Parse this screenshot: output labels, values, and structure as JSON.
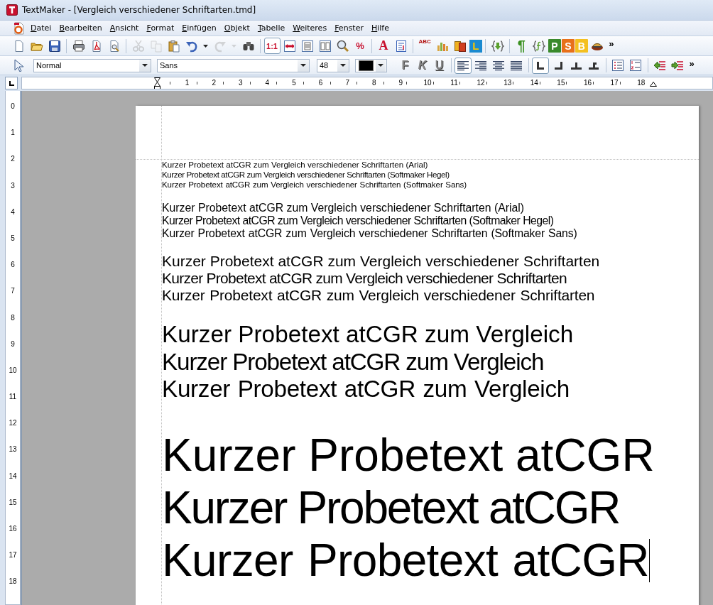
{
  "window": {
    "title": "TextMaker - [Vergleich verschiedener Schriftarten.tmd]"
  },
  "menu": [
    {
      "label": "Datei"
    },
    {
      "label": "Bearbeiten"
    },
    {
      "label": "Ansicht"
    },
    {
      "label": "Format"
    },
    {
      "label": "Einfügen"
    },
    {
      "label": "Objekt"
    },
    {
      "label": "Tabelle"
    },
    {
      "label": "Weiteres"
    },
    {
      "label": "Fenster"
    },
    {
      "label": "Hilfe"
    }
  ],
  "toolbar": [
    {
      "kind": "button",
      "disabled": false
    },
    {
      "kind": "button",
      "disabled": false
    },
    {
      "kind": "button",
      "disabled": false
    },
    {
      "kind": "separator"
    },
    {
      "kind": "button",
      "disabled": false
    },
    {
      "kind": "button",
      "disabled": false
    },
    {
      "kind": "button",
      "disabled": false
    },
    {
      "kind": "separator"
    },
    {
      "kind": "button",
      "disabled": true
    },
    {
      "kind": "button",
      "disabled": true
    },
    {
      "kind": "button",
      "disabled": false
    },
    {
      "kind": "button",
      "disabled": false
    },
    {
      "kind": "caret",
      "disabled": false
    },
    {
      "kind": "button",
      "disabled": true
    },
    {
      "kind": "caret",
      "disabled": true
    },
    {
      "kind": "button",
      "disabled": false
    },
    {
      "kind": "separator"
    },
    {
      "kind": "button",
      "label": "1:1",
      "selected": true,
      "disabled": false
    },
    {
      "kind": "button",
      "disabled": false
    },
    {
      "kind": "button",
      "disabled": false
    },
    {
      "kind": "button",
      "disabled": false
    },
    {
      "kind": "button",
      "disabled": false
    },
    {
      "kind": "button",
      "label": "%",
      "disabled": false
    },
    {
      "kind": "separator"
    },
    {
      "kind": "button",
      "label": "A",
      "disabled": false
    },
    {
      "kind": "button",
      "disabled": false
    },
    {
      "kind": "separator"
    },
    {
      "kind": "button",
      "label": "ABC",
      "disabled": false
    },
    {
      "kind": "button",
      "disabled": false
    },
    {
      "kind": "button",
      "disabled": false
    },
    {
      "kind": "button",
      "label": "L",
      "disabled": false
    },
    {
      "kind": "separator"
    },
    {
      "kind": "button",
      "disabled": false
    },
    {
      "kind": "separator"
    },
    {
      "kind": "button",
      "label": "¶",
      "disabled": false
    },
    {
      "kind": "button",
      "disabled": false
    },
    {
      "kind": "button",
      "label": "P",
      "disabled": false
    },
    {
      "kind": "button",
      "label": "S",
      "disabled": false
    },
    {
      "kind": "button",
      "label": "B",
      "disabled": false
    },
    {
      "kind": "button",
      "disabled": false
    },
    {
      "kind": "overflow",
      "label": "»"
    }
  ],
  "format_bar": {
    "style": "Normal",
    "font": "Sans",
    "size": "48",
    "color": "#000000",
    "text_styles": [
      {
        "label": "F",
        "selected": false
      },
      {
        "label": "K",
        "selected": false
      },
      {
        "label": "U",
        "selected": false
      }
    ],
    "alignment": [
      {
        "selected": true
      },
      {
        "selected": false
      },
      {
        "selected": false
      },
      {
        "selected": false
      }
    ],
    "tab_stops": [
      {
        "selected": true
      },
      {
        "selected": false
      },
      {
        "selected": false
      },
      {
        "selected": false
      }
    ],
    "overflow": "»"
  },
  "horizontal_ruler": [
    "1",
    "2",
    "3",
    "4",
    "5",
    "6",
    "7",
    "8",
    "9",
    "10",
    "11",
    "12",
    "13",
    "14",
    "15",
    "16",
    "17",
    "18"
  ],
  "vertical_ruler": [
    "0",
    "1",
    "2",
    "3",
    "4",
    "5",
    "6",
    "7",
    "8",
    "9",
    "10",
    "11",
    "12",
    "13",
    "14",
    "15",
    "16",
    "17",
    "18"
  ],
  "document": {
    "groups": [
      {
        "lines": [
          {
            "text": "Kurzer Probetext atCGR zum Vergleich verschiedener Schriftarten (Arial)",
            "kind": "arial"
          },
          {
            "text": "Kurzer Probetext atCGR zum Vergleich verschiedener Schriftarten (Softmaker Hegel)",
            "kind": "hegel"
          },
          {
            "text": "Kurzer Probetext atCGR zum Vergleich verschiedener Schriftarten (Softmaker Sans)",
            "kind": "sans"
          }
        ]
      },
      {
        "lines": [
          {
            "text": "Kurzer Probetext atCGR zum Vergleich verschiedener Schriftarten (Arial)",
            "kind": "arial"
          },
          {
            "text": "Kurzer Probetext atCGR zum Vergleich verschiedener Schriftarten (Softmaker Hegel)",
            "kind": "hegel"
          },
          {
            "text": "Kurzer Probetext atCGR zum Vergleich verschiedener Schriftarten (Softmaker Sans)",
            "kind": "sans"
          }
        ]
      },
      {
        "lines": [
          {
            "text": "Kurzer Probetext atCGR zum Vergleich verschiedener Schriftarten",
            "kind": "arial"
          },
          {
            "text": "Kurzer Probetext atCGR zum Vergleich verschiedener Schriftarten",
            "kind": "hegel"
          },
          {
            "text": "Kurzer Probetext atCGR zum Vergleich verschiedener Schriftarten",
            "kind": "sans"
          }
        ]
      },
      {
        "lines": [
          {
            "text": "Kurzer Probetext atCGR zum Vergleich",
            "kind": "arial"
          },
          {
            "text": "Kurzer Probetext atCGR zum Vergleich",
            "kind": "hegel"
          },
          {
            "text": "Kurzer Probetext atCGR zum Vergleich",
            "kind": "sans"
          }
        ]
      },
      {
        "lines": [
          {
            "text": "Kurzer Probetext atCGR",
            "kind": "arial"
          },
          {
            "text": "Kurzer Probetext atCGR",
            "kind": "hegel"
          },
          {
            "text": "Kurzer Probetext atCGR",
            "kind": "sans"
          }
        ]
      }
    ]
  }
}
